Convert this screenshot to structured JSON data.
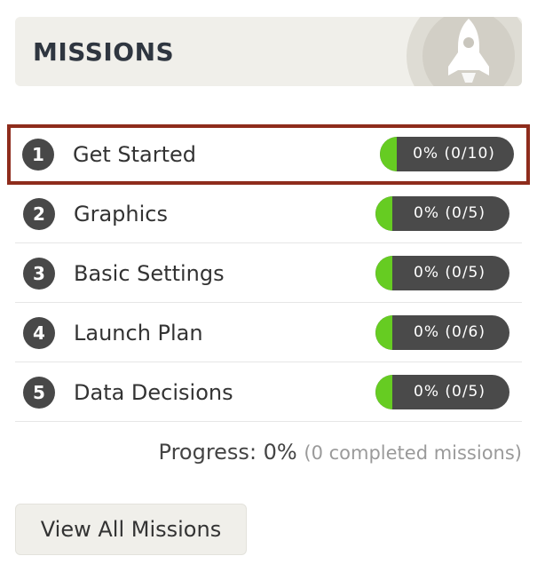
{
  "header": {
    "title": "MISSIONS",
    "icon": "rocket-icon"
  },
  "colors": {
    "progress_fill": "#66cc22",
    "pill_bg": "#4a4a4a",
    "active_border": "#8e2c1c"
  },
  "missions": [
    {
      "number": "1",
      "title": "Get Started",
      "progress_text": "0% (0/10)",
      "progress": 0,
      "active": true
    },
    {
      "number": "2",
      "title": "Graphics",
      "progress_text": "0% (0/5)",
      "progress": 0,
      "active": false
    },
    {
      "number": "3",
      "title": "Basic Settings",
      "progress_text": "0% (0/5)",
      "progress": 0,
      "active": false
    },
    {
      "number": "4",
      "title": "Launch Plan",
      "progress_text": "0% (0/6)",
      "progress": 0,
      "active": false
    },
    {
      "number": "5",
      "title": "Data Decisions",
      "progress_text": "0% (0/5)",
      "progress": 0,
      "active": false
    }
  ],
  "progress": {
    "label": "Progress: 0%",
    "detail": "(0 completed missions)"
  },
  "view_all_label": "View All Missions"
}
